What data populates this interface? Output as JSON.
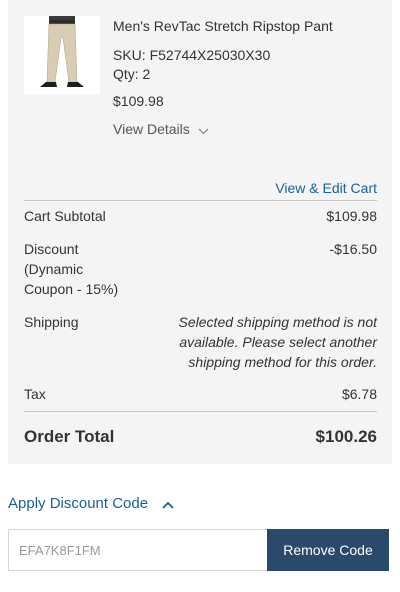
{
  "product": {
    "name": "Men's RevTac Stretch Ripstop Pant",
    "sku": "SKU: F52744X25030X30",
    "qty": "Qty: 2",
    "price": "$109.98",
    "view_details": "View Details",
    "image_icon": "pant-thumbnail"
  },
  "cart_link": "View & Edit Cart",
  "totals": {
    "subtotal_label": "Cart Subtotal",
    "subtotal_value": "$109.98",
    "discount_label_1": "Discount",
    "discount_label_2": "(Dynamic",
    "discount_label_3": "Coupon - 15%)",
    "discount_value": "-$16.50",
    "shipping_label": "Shipping",
    "shipping_note": "Selected shipping method is not available. Please select another shipping method for this order.",
    "tax_label": "Tax",
    "tax_value": "$6.78",
    "order_total_label": "Order Total",
    "order_total_value": "$100.26"
  },
  "discount_code": {
    "toggle_label": "Apply Discount Code",
    "input_value": "EFA7K8F1FM",
    "remove_label": "Remove Code"
  },
  "colors": {
    "link": "#1a5f9b",
    "button_bg": "#2a4a6b",
    "panel_bg": "#f4f4f4"
  }
}
